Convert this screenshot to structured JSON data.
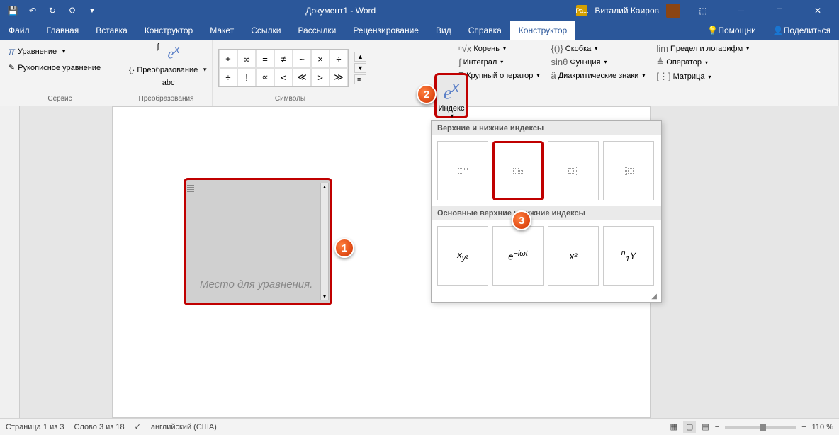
{
  "title": "Документ1 - Word",
  "user": "Виталий Каиров",
  "share_badge": "Ра...",
  "tabs": [
    "Файл",
    "Главная",
    "Вставка",
    "Конструктор",
    "Макет",
    "Ссылки",
    "Рассылки",
    "Рецензирование",
    "Вид",
    "Справка",
    "Конструктор"
  ],
  "tab_right": {
    "help": "Помощни",
    "share": "Поделиться"
  },
  "ribbon": {
    "service": {
      "label": "Сервис",
      "equation": "Уравнение",
      "ink": "Рукописное уравнение"
    },
    "transforms": {
      "label": "Преобразования",
      "convert": "Преобразование",
      "abc": "abc",
      "ex": "e^x"
    },
    "symbols": {
      "label": "Символы",
      "row1": [
        "±",
        "∞",
        "=",
        "≠",
        "~",
        "×",
        "÷"
      ],
      "row2": [
        "÷",
        "!",
        "∝",
        "<",
        "≪",
        ">",
        "≫"
      ]
    },
    "structures": {
      "index": "Индекс",
      "items": [
        {
          "icon": "√",
          "label": "Корень"
        },
        {
          "icon": "∫",
          "label": "Интеграл"
        },
        {
          "icon": "Σ",
          "label": "Крупный оператор"
        },
        {
          "icon": "{()}",
          "label": "Скобка"
        },
        {
          "icon": "sinθ",
          "label": "Функция"
        },
        {
          "icon": "ä",
          "label": "Диакритические знаки"
        },
        {
          "icon": "lim",
          "label": "Предел и логарифм"
        },
        {
          "icon": "Δ",
          "label": "Оператор"
        },
        {
          "icon": "[⋮]",
          "label": "Матрица"
        }
      ]
    }
  },
  "equation_placeholder": "Место для уравнения.",
  "gallery": {
    "section1": "Верхние и нижние индексы",
    "section2": "Основные верхние и нижние индексы",
    "examples": [
      "x_{y²}",
      "e^{−iωt}",
      "x²",
      "ⁿ₁Y"
    ]
  },
  "callouts": {
    "c1": "1",
    "c2": "2",
    "c3": "3"
  },
  "status": {
    "page": "Страница 1 из 3",
    "words": "Слово 3 из 18",
    "lang": "английский (США)",
    "zoom": "110 %"
  }
}
